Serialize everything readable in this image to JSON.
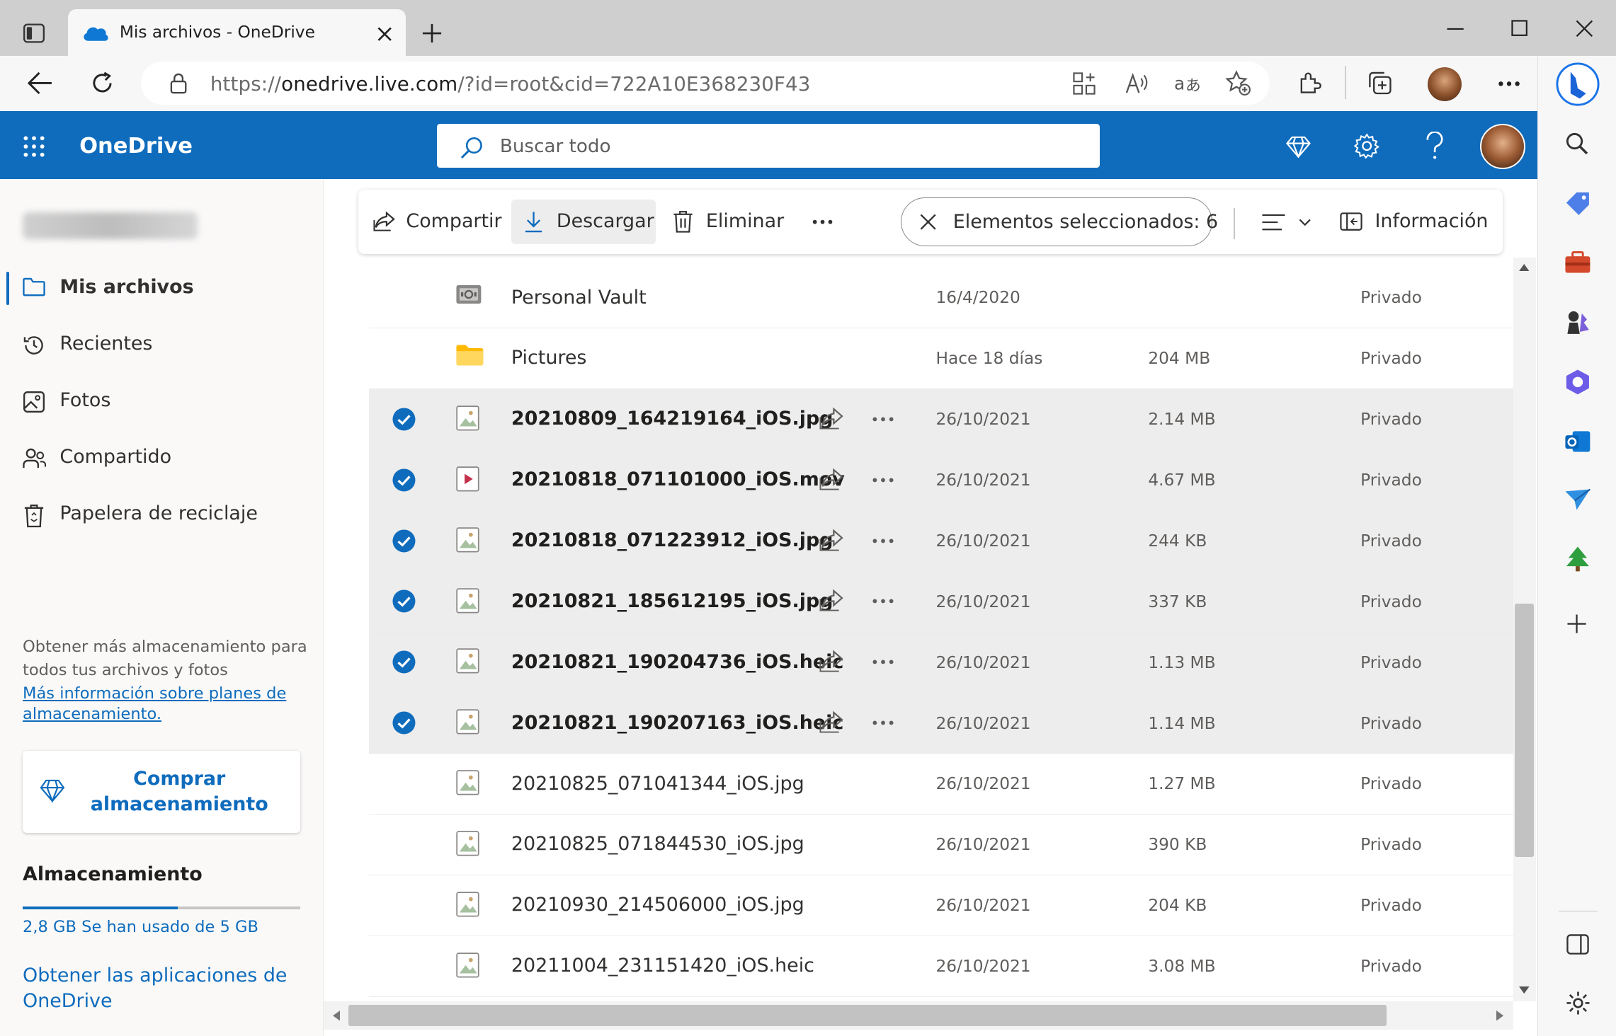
{
  "browser": {
    "tab_title": "Mis archivos - OneDrive",
    "url_prefix": "https://",
    "url_host": "onedrive.live.com",
    "url_path": "/?id=root&cid=722A10E368230F43"
  },
  "header": {
    "brand": "OneDrive",
    "search_placeholder": "Buscar todo"
  },
  "sidebar": {
    "items": [
      {
        "label": "Mis archivos"
      },
      {
        "label": "Recientes"
      },
      {
        "label": "Fotos"
      },
      {
        "label": "Compartido"
      },
      {
        "label": "Papelera de reciclaje"
      }
    ],
    "promo_line1": "Obtener más almacenamiento para",
    "promo_line2": "todos tus archivos y fotos",
    "promo_link_line1": "Más información sobre planes de",
    "promo_link_line2": "almacenamiento.",
    "buy_line1": "Comprar",
    "buy_line2": "almacenamiento",
    "storage_heading": "Almacenamiento",
    "storage_used_fraction": 0.56,
    "storage_text": "2,8 GB Se han usado de 5 GB",
    "apps_line1": "Obtener las aplicaciones de",
    "apps_line2": "OneDrive"
  },
  "commandbar": {
    "share": "Compartir",
    "download": "Descargar",
    "delete": "Eliminar",
    "selected": "Elementos seleccionados: 6",
    "info": "Información"
  },
  "files": [
    {
      "name": "Personal Vault",
      "modified": "16/4/2020",
      "size": "",
      "sharing": "Privado",
      "icon": "vault-icon",
      "selected": false
    },
    {
      "name": "Pictures",
      "modified": "Hace 18 días",
      "size": "204 MB",
      "sharing": "Privado",
      "icon": "folder-icon",
      "selected": false
    },
    {
      "name": "20210809_164219164_iOS.jpg",
      "modified": "26/10/2021",
      "size": "2.14 MB",
      "sharing": "Privado",
      "icon": "image-file-icon",
      "selected": true
    },
    {
      "name": "20210818_071101000_iOS.mov",
      "modified": "26/10/2021",
      "size": "4.67 MB",
      "sharing": "Privado",
      "icon": "video-file-icon",
      "selected": true
    },
    {
      "name": "20210818_071223912_iOS.jpg",
      "modified": "26/10/2021",
      "size": "244 KB",
      "sharing": "Privado",
      "icon": "image-file-icon",
      "selected": true
    },
    {
      "name": "20210821_185612195_iOS.jpg",
      "modified": "26/10/2021",
      "size": "337 KB",
      "sharing": "Privado",
      "icon": "image-file-icon",
      "selected": true
    },
    {
      "name": "20210821_190204736_iOS.heic",
      "modified": "26/10/2021",
      "size": "1.13 MB",
      "sharing": "Privado",
      "icon": "image-file-icon",
      "selected": true
    },
    {
      "name": "20210821_190207163_iOS.heic",
      "modified": "26/10/2021",
      "size": "1.14 MB",
      "sharing": "Privado",
      "icon": "image-file-icon",
      "selected": true
    },
    {
      "name": "20210825_071041344_iOS.jpg",
      "modified": "26/10/2021",
      "size": "1.27 MB",
      "sharing": "Privado",
      "icon": "image-file-icon",
      "selected": false
    },
    {
      "name": "20210825_071844530_iOS.jpg",
      "modified": "26/10/2021",
      "size": "390 KB",
      "sharing": "Privado",
      "icon": "image-file-icon",
      "selected": false
    },
    {
      "name": "20210930_214506000_iOS.jpg",
      "modified": "26/10/2021",
      "size": "204 KB",
      "sharing": "Privado",
      "icon": "image-file-icon",
      "selected": false
    },
    {
      "name": "20211004_231151420_iOS.heic",
      "modified": "26/10/2021",
      "size": "3.08 MB",
      "sharing": "Privado",
      "icon": "image-file-icon",
      "selected": false
    }
  ],
  "colors": {
    "brand_blue": "#0f6cbd",
    "selected_row": "#ededed"
  }
}
